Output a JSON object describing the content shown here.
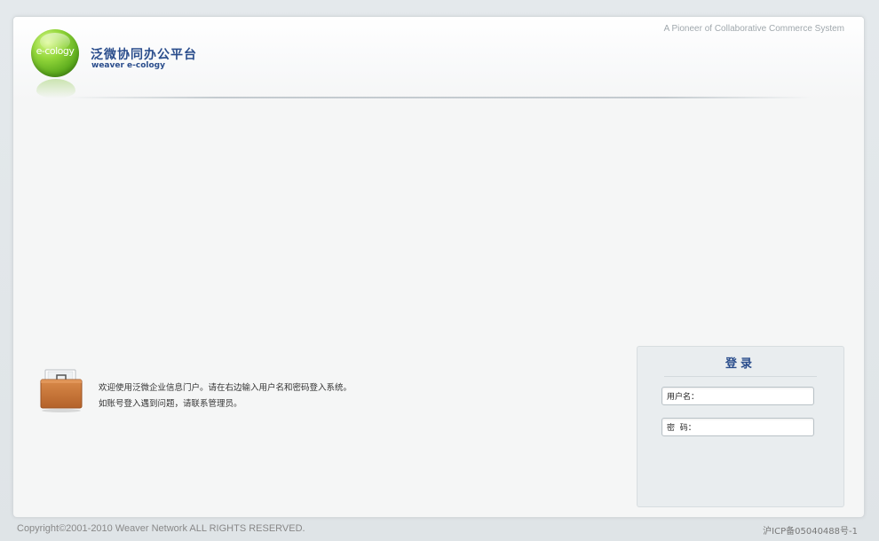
{
  "header": {
    "logo_text": "e-cology",
    "brand_cn": "泛微协同办公平台",
    "brand_en": "weaver e-cology",
    "tagline": "A Pioneer of Collaborative Commerce System"
  },
  "welcome": {
    "line1": "欢迎使用泛微企业信息门户。请在右边输入用户名和密码登入系统。",
    "line2": "如账号登入遇到问题，请联系管理员。",
    "icon": "briefcase-icon"
  },
  "login": {
    "title": "登录",
    "username_label": "用户名：",
    "username_value": "",
    "password_label": "密  码：",
    "password_value": ""
  },
  "footer": {
    "copyright": "Copyright©2001-2010 Weaver Network ALL RIGHTS RESERVED.",
    "icp": "沪ICP备05040488号-1"
  },
  "colors": {
    "brand_blue": "#2a4d8c",
    "logo_green": "#7cc42c",
    "page_bg": "#e4e9ec",
    "panel_bg": "#f5f6f6"
  }
}
